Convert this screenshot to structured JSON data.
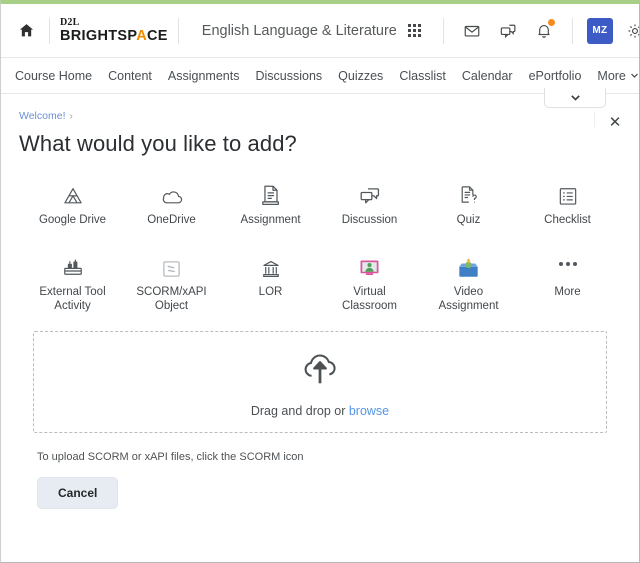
{
  "window": {
    "accent_top_color": "#a8cf88",
    "border_color": "#b8b8b8"
  },
  "navbar": {
    "home_icon": "home-icon",
    "brand": {
      "line1": "D2L",
      "line2_before": "BRIGHTSP",
      "line2_accent": "A",
      "line2_after": "CE",
      "accent_color": "#f08c00"
    },
    "course_title": "English Language & Literature",
    "icons": [
      {
        "name": "waffle-menu-icon",
        "label": "Course selector"
      },
      {
        "name": "envelope-icon",
        "label": "Email"
      },
      {
        "name": "chat-icon",
        "label": "Subscriptions"
      },
      {
        "name": "bell-icon",
        "label": "Notifications",
        "badge": true,
        "badge_color": "#f68c1f"
      }
    ],
    "avatar": {
      "initials": "MZ",
      "background": "#3d5bc4"
    },
    "settings_icon": "gear-icon"
  },
  "course_nav": {
    "links": [
      {
        "label": "Course Home"
      },
      {
        "label": "Content"
      },
      {
        "label": "Assignments"
      },
      {
        "label": "Discussions"
      },
      {
        "label": "Quizzes"
      },
      {
        "label": "Classlist"
      },
      {
        "label": "Calendar"
      },
      {
        "label": "ePortfolio"
      },
      {
        "label": "More"
      }
    ],
    "more_caret": "chevron-down-icon"
  },
  "dropdown_stub": {
    "caret": "chevron-down-icon"
  },
  "panel": {
    "breadcrumb": {
      "label": "Welcome!",
      "separator": "›"
    },
    "title": "What would you like to add?",
    "close_label": "✕",
    "tiles": [
      {
        "label": "Google Drive",
        "icon": "google-drive-icon"
      },
      {
        "label": "OneDrive",
        "icon": "onedrive-cloud-icon"
      },
      {
        "label": "Assignment",
        "icon": "assignment-document-icon"
      },
      {
        "label": "Discussion",
        "icon": "discussion-bubbles-icon"
      },
      {
        "label": "Quiz",
        "icon": "quiz-question-icon"
      },
      {
        "label": "Checklist",
        "icon": "checklist-icon"
      },
      {
        "label": "External Tool Activity",
        "icon": "external-tool-icon"
      },
      {
        "label": "SCORM/xAPI Object",
        "icon": "scorm-package-icon"
      },
      {
        "label": "LOR",
        "icon": "lor-bank-icon"
      },
      {
        "label": "Virtual Classroom",
        "icon": "virtual-classroom-icon"
      },
      {
        "label": "Video Assignment",
        "icon": "video-assignment-icon"
      },
      {
        "label": "More",
        "icon": "ellipsis-icon"
      }
    ],
    "dropzone": {
      "icon": "cloud-upload-icon",
      "text_before": "Drag and drop or ",
      "browse_label": "browse",
      "browse_color": "#5596e6"
    },
    "hint": "To upload SCORM or xAPI files, click the SCORM icon",
    "cancel_label": "Cancel"
  }
}
